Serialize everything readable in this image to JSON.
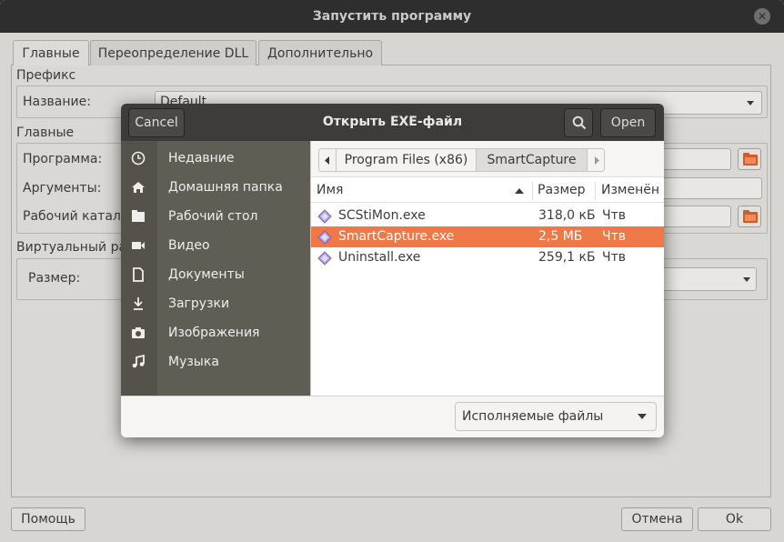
{
  "window": {
    "title": "Запустить программу",
    "tabs": [
      "Главные",
      "Переопределение DLL",
      "Дополнительно"
    ],
    "prefix_section": "Префикс",
    "name_label": "Название:",
    "name_value": "Default",
    "main_section": "Главные",
    "program_label": "Программа:",
    "args_label": "Аргументы:",
    "workdir_label": "Рабочий катало",
    "virtual_section": "Виртуальный ра",
    "size_label": "Размер:",
    "help_button": "Помощь",
    "cancel_button": "Отмена",
    "ok_button": "Ok"
  },
  "dialog": {
    "title": "Открыть EXE-файл",
    "cancel": "Cancel",
    "open": "Open",
    "search_icon": "search-icon",
    "places": [
      {
        "label": "Недавние",
        "icon": "clock-icon"
      },
      {
        "label": "Домашняя папка",
        "icon": "home-icon"
      },
      {
        "label": "Рабочий стол",
        "icon": "desktop-icon"
      },
      {
        "label": "Видео",
        "icon": "video-icon"
      },
      {
        "label": "Документы",
        "icon": "document-icon"
      },
      {
        "label": "Загрузки",
        "icon": "download-icon"
      },
      {
        "label": "Изображения",
        "icon": "camera-icon"
      },
      {
        "label": "Музыка",
        "icon": "music-icon"
      }
    ],
    "path": [
      "Program Files (x86)",
      "SmartCapture"
    ],
    "columns": {
      "name": "Имя",
      "size": "Размер",
      "modified": "Изменён"
    },
    "files": [
      {
        "name": "SCStiMon.exe",
        "size": "318,0 кБ",
        "modified": "Чтв",
        "selected": false
      },
      {
        "name": "SmartCapture.exe",
        "size": "2,5 МБ",
        "modified": "Чтв",
        "selected": true
      },
      {
        "name": "Uninstall.exe",
        "size": "259,1 кБ",
        "modified": "Чтв",
        "selected": false
      }
    ],
    "filter": "Исполняемые файлы"
  },
  "colors": {
    "accent": "#f07746",
    "sidebar": "#5f5d54",
    "header": "#3d3c3a"
  }
}
